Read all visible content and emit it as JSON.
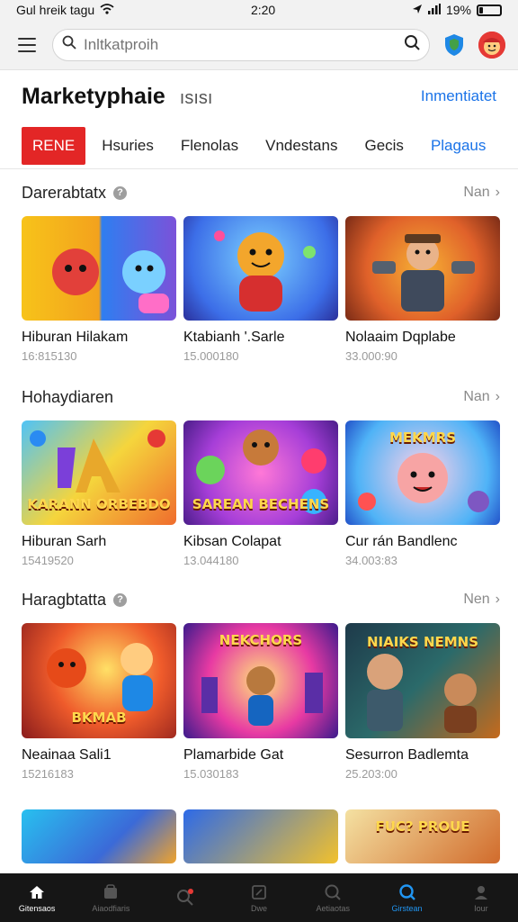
{
  "status": {
    "carrier": "Gul hreik tagu",
    "time": "2:20",
    "battery": "19%",
    "battery_level": 0.19
  },
  "search": {
    "placeholder": "Inltkatproih",
    "value": ""
  },
  "header": {
    "title": "Marketyphaie",
    "subtitle": "ısısı",
    "link": "Inmentiatet"
  },
  "tabs": [
    {
      "label": "RENE",
      "active": true
    },
    {
      "label": "Hsuries"
    },
    {
      "label": "Flenolas"
    },
    {
      "label": "Vndestans"
    },
    {
      "label": "Gecis"
    },
    {
      "label": "Plagaus",
      "accent": true
    }
  ],
  "sections": [
    {
      "title": "Darerabtatx",
      "more": "Nan",
      "cards": [
        {
          "title": "Hiburan Hilakam",
          "count": "16:815130",
          "thumb_text": ""
        },
        {
          "title": "Ktabianh '.Sarle",
          "count": "15.000180",
          "thumb_text": ""
        },
        {
          "title": "Nolaaim Dqplabe",
          "count": "33.000:90",
          "thumb_text": ""
        }
      ]
    },
    {
      "title": "Hohaydiaren",
      "more": "Nan",
      "cards": [
        {
          "title": "Hiburan Sarh",
          "count": "15419520",
          "thumb_text": "KARANN ORBEBDO"
        },
        {
          "title": "Kibsan Colapat",
          "count": "13.044180",
          "thumb_text": "SAREAN BECHENS"
        },
        {
          "title": "Cur rán Bandlenc",
          "count": "34.003:83",
          "thumb_text": "MEKMRS"
        }
      ]
    },
    {
      "title": "Haragbtatta",
      "more": "Nen",
      "cards": [
        {
          "title": "Neainaa Sali1",
          "count": "15216183",
          "thumb_text": "BKMAB"
        },
        {
          "title": "Plamarbide Gat",
          "count": "15.030183",
          "thumb_text": "NEKCHORS"
        },
        {
          "title": "Sesurron Badlemta",
          "count": "25.203:00",
          "thumb_text": "NIAIKS NEMNS"
        }
      ]
    },
    {
      "title": "",
      "more": "",
      "cards": [
        {
          "title": "",
          "count": "",
          "thumb_text": ""
        },
        {
          "title": "",
          "count": "",
          "thumb_text": ""
        },
        {
          "title": "",
          "count": "",
          "thumb_text": "FUC? PROUE"
        }
      ]
    }
  ],
  "nav": [
    {
      "label": "Gitensaos",
      "icon": "home-icon"
    },
    {
      "label": "Aiaodfiaris",
      "icon": "store-icon"
    },
    {
      "label": "",
      "icon": "search-badge-icon"
    },
    {
      "label": "Dwe",
      "icon": "library-icon"
    },
    {
      "label": "Aetiaotas",
      "icon": "chat-icon"
    },
    {
      "label": "Girstean",
      "icon": "discover-icon"
    },
    {
      "label": "Iour",
      "icon": "profile-icon"
    }
  ]
}
